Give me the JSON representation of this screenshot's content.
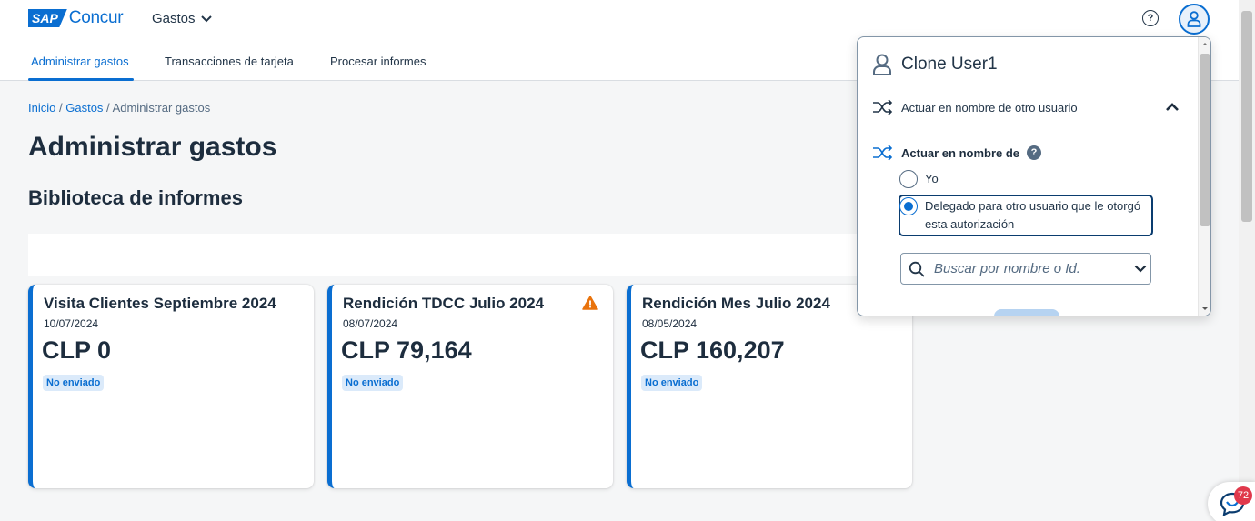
{
  "header": {
    "logo_badge": "SAP",
    "logo_text": "Concur",
    "app_switcher": "Gastos",
    "help_icon": "question-circle-icon",
    "profile_icon": "user-icon",
    "accent": "#0a6ed1"
  },
  "nav": {
    "tabs": [
      {
        "label": "Administrar gastos",
        "active": true
      },
      {
        "label": "Transacciones de tarjeta",
        "active": false
      },
      {
        "label": "Procesar informes",
        "active": false
      }
    ]
  },
  "breadcrumb": {
    "items": [
      "Inicio",
      "Gastos",
      "Administrar gastos"
    ],
    "separator": "/"
  },
  "page": {
    "title": "Administrar gastos",
    "section": "Biblioteca de informes"
  },
  "reports": [
    {
      "title": "Visita Clientes Septiembre 2024",
      "date": "10/07/2024",
      "amount": "CLP 0",
      "status": "No enviado",
      "warning": false
    },
    {
      "title": "Rendición TDCC Julio 2024",
      "date": "08/07/2024",
      "amount": "CLP 79,164",
      "status": "No enviado",
      "warning": true
    },
    {
      "title": "Rendición Mes Julio 2024",
      "date": "08/05/2024",
      "amount": "CLP 160,207",
      "status": "No enviado",
      "warning": false
    }
  ],
  "profile_panel": {
    "user_name": "Clone User1",
    "act_on_behalf_row": "Actuar en nombre de otro usuario",
    "act_as_label": "Actuar en nombre de",
    "options": [
      {
        "label": "Yo",
        "selected": false
      },
      {
        "label": "Delegado para otro usuario que le otorgó esta autorización",
        "selected": true
      }
    ],
    "search_placeholder": "Buscar por nombre o Id."
  },
  "chat": {
    "badge_count": "72"
  },
  "colors": {
    "warning": "#e9730c",
    "badge_bg": "#dbeafa"
  }
}
